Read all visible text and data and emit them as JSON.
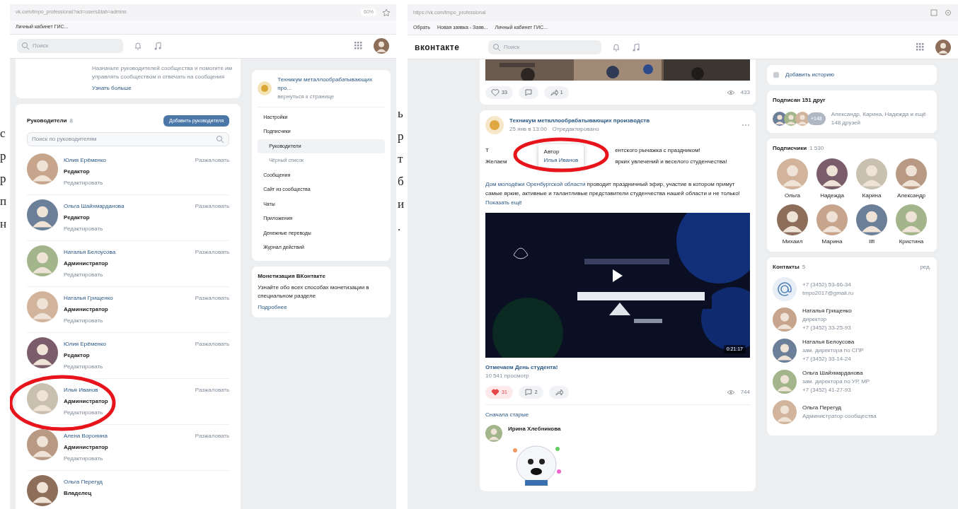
{
  "document_fragments": {
    "left": [
      "с",
      "р",
      "р",
      "п",
      "н"
    ],
    "middle": [
      "ь",
      "р",
      "т",
      "б",
      "и",
      "."
    ]
  },
  "left_window": {
    "browser": {
      "address": "vk.com/tmpo_professional?act=users&tab=admins",
      "zoom": "60%",
      "bookmarks": [
        "Личный кабинет ГИС..."
      ]
    },
    "header": {
      "search_placeholder": "Поиск"
    },
    "intro_card": {
      "lines": [
        "Назначьте руководителей сообщества и помогите им",
        "управлять сообществом и отвечать на сообщения"
      ],
      "link": "Узнать больше"
    },
    "leaders": {
      "title": "Руководители",
      "count": "8",
      "add_button": "Добавить руководителя",
      "search_placeholder": "Поиск по руководителям",
      "rows": [
        {
          "name": "Юлия Ерёменко",
          "role": "Редактор",
          "edit": "Редактировать",
          "action": "Разжаловать",
          "highlighted": false
        },
        {
          "name": "Ольга Шайхмарданова",
          "role": "Редактор",
          "edit": "Редактировать",
          "action": "Разжаловать",
          "highlighted": false
        },
        {
          "name": "Наталья Белоусова",
          "role": "Администратор",
          "edit": "Редактировать",
          "action": "Разжаловать",
          "highlighted": false
        },
        {
          "name": "Наталья Грищенко",
          "role": "Администратор",
          "edit": "Редактировать",
          "action": "Разжаловать",
          "highlighted": false
        },
        {
          "name": "Юлия Ерёменко",
          "role": "Редактор",
          "edit": "Редактировать",
          "action": "Разжаловать",
          "highlighted": false
        },
        {
          "name": "Илья Иванов",
          "role": "Администратор",
          "edit": "Редактировать",
          "action": "Разжаловать",
          "highlighted": true
        },
        {
          "name": "Алена Воронина",
          "role": "Администратор",
          "edit": "Редактировать",
          "action": "Разжаловать",
          "highlighted": false
        },
        {
          "name": "Ольга Перегуд",
          "role": "Владелец",
          "highlighted": false
        }
      ]
    },
    "menu": {
      "group_name": "Техникум металлообрабатывающих про...",
      "group_sub": "вернуться к странице",
      "items": [
        {
          "label": "Настройки",
          "kind": "item",
          "selected": false
        },
        {
          "label": "Подписчики",
          "kind": "item",
          "selected": false
        },
        {
          "label": "Руководители",
          "kind": "sub",
          "selected": true
        },
        {
          "label": "Чёрный список",
          "kind": "sub",
          "selected": false
        },
        {
          "label": "Сообщения",
          "kind": "item",
          "selected": false
        },
        {
          "label": "Сайт из сообщества",
          "kind": "item",
          "selected": false
        },
        {
          "label": "Чаты",
          "kind": "item",
          "selected": false
        },
        {
          "label": "Приложения",
          "kind": "item",
          "selected": false
        },
        {
          "label": "Денежные переводы",
          "kind": "item",
          "selected": false
        },
        {
          "label": "Журнал действий",
          "kind": "item",
          "selected": false
        }
      ]
    },
    "monetization": {
      "title": "Монетизация ВКонтакте",
      "text": "Узнайте обо всех способах монетизации в специальном разделе",
      "link": "Подробнее"
    }
  },
  "right_window": {
    "browser": {
      "address": "https://vk.com/tmpo_professional",
      "bookmarks": [
        "Обрать",
        "Новая заявка - Заяв...",
        "Личный кабинет ГИС..."
      ]
    },
    "header": {
      "logo": "вконтакте",
      "search_placeholder": "Поиск"
    },
    "prev_post": {
      "likes": "33",
      "reposts": "1",
      "views": "433"
    },
    "post": {
      "author": "Техникум металлообрабатывающих производств",
      "date": "25 янв в 13:00",
      "edited": "Отредактировано",
      "tooltip": {
        "title": "Автор",
        "name": "Илья Иванов",
        "highlighted": true
      },
      "line_left": [
        "Т",
        "Желаем"
      ],
      "line_right": [
        "ентского рычажка с праздником!",
        "ярких увлечений и веселого студенчества!"
      ],
      "link": "Дом молодёжи Оренбургской области",
      "text": "проводит праздничный эфир, участие в котором примут самые яркие, активные и талантливые представители студенчества нашей области и не только!",
      "more": "Показать ещё",
      "video_duration": "0:21:17",
      "video_title": "Отмечаем День студента!",
      "video_views": "10 541 просмотр",
      "likes": "31",
      "liked": true,
      "comments": "2",
      "views": "744"
    },
    "comments": {
      "sort": "Сначала старые",
      "author": "Ирина Хлебникова"
    },
    "side": {
      "add_story": "Добавить историю",
      "friends_title": "Подписан 151 друг",
      "friends_more": "+148",
      "friends_text": "Александр, Карина, Надежда и ещё 148 друзей",
      "followers_title": "Подписчики",
      "followers_count": "1 530",
      "followers": [
        "Ольга",
        "Надежда",
        "Карина",
        "Александр",
        "Михаил",
        "Марина",
        "Ilfi",
        "Кристина"
      ],
      "contacts_title": "Контакты",
      "contacts_count": "5",
      "contacts_edit": "ред.",
      "contacts": [
        {
          "kind": "group",
          "lines": [
            "+7 (3452) 53-66-34",
            "tmpo2017@gmail.ru"
          ]
        },
        {
          "kind": "person",
          "name": "Наталья Грищенко",
          "lines": [
            "директор",
            "+7 (3452) 33-25-93"
          ]
        },
        {
          "kind": "person",
          "name": "Наталья Белоусова",
          "lines": [
            "зам. директора по СПР",
            "+7 (3452) 33-14-24"
          ]
        },
        {
          "kind": "person",
          "name": "Ольга Шайхмарданова",
          "lines": [
            "зам. директора по УР, МР",
            "+7 (3452) 41-27-93"
          ]
        },
        {
          "kind": "person",
          "name": "Ольга Перегуд",
          "lines": [
            "Администратор сообщества"
          ]
        }
      ]
    }
  }
}
